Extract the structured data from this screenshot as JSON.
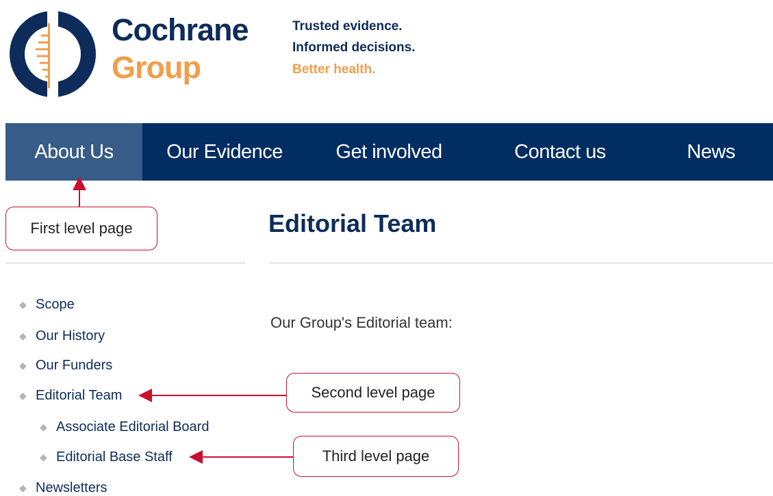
{
  "header": {
    "brand_line1": "Cochrane",
    "brand_line2": "Group",
    "tagline_line1": "Trusted evidence.",
    "tagline_line2": "Informed decisions.",
    "tagline_line3": "Better health."
  },
  "nav": {
    "items": [
      {
        "label": "About Us",
        "active": true
      },
      {
        "label": "Our Evidence"
      },
      {
        "label": "Get involved"
      },
      {
        "label": "Contact us"
      },
      {
        "label": "News"
      }
    ]
  },
  "sidebar": {
    "items": [
      {
        "label": "Scope"
      },
      {
        "label": "Our History"
      },
      {
        "label": "Our Funders"
      },
      {
        "label": "Editorial Team"
      },
      {
        "label": "Associate Editorial Board"
      },
      {
        "label": "Editorial Base Staff"
      },
      {
        "label": "Newsletters"
      }
    ]
  },
  "main": {
    "title": "Editorial Team",
    "intro": "Our Group's Editorial team:"
  },
  "annotations": {
    "first": "First level page",
    "second": "Second level page",
    "third": "Third level page"
  },
  "colors": {
    "navy": "#002d62",
    "nav_active": "#375c87",
    "brand_orange": "#f29d4a",
    "annotation_red": "#c8102e"
  }
}
